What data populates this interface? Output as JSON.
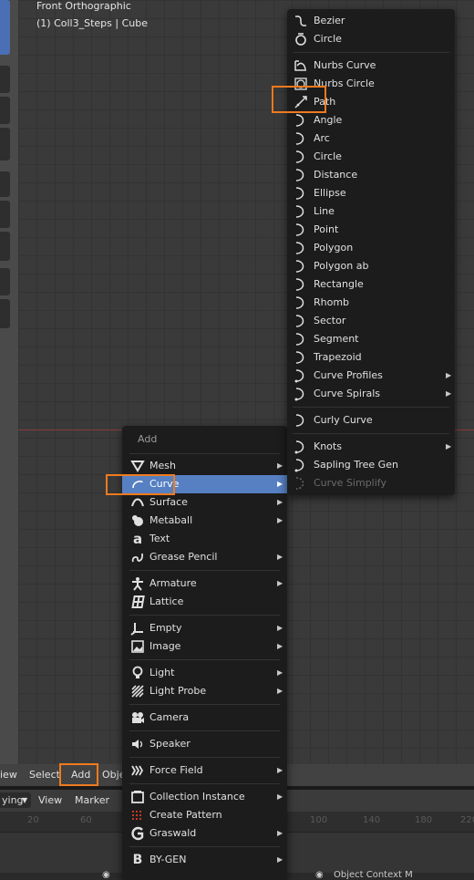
{
  "viewport": {
    "view_name": "Front Orthographic",
    "object_info": "(1) Coll3_Steps | Cube"
  },
  "header": {
    "view": "iew",
    "select": "Select",
    "add": "Add",
    "object": "Obje"
  },
  "timeline": {
    "mode": "ying",
    "view": "View",
    "marker": "Marker",
    "ticks": [
      "20",
      "60",
      "100",
      "140",
      "180",
      "220"
    ]
  },
  "statusbar": {
    "right_text": "Object Context M"
  },
  "add_menu": {
    "title": "Add",
    "items": [
      {
        "label": "Mesh",
        "icon": "mesh-icon"
      },
      {
        "label": "Curve",
        "icon": "curve-icon"
      },
      {
        "label": "Surface",
        "icon": "surface-icon"
      },
      {
        "label": "Metaball",
        "icon": "metaball-icon"
      },
      {
        "label": "Text",
        "icon": "text-icon"
      },
      {
        "label": "Grease Pencil",
        "icon": "grease-pencil-icon"
      },
      {
        "label": "Armature",
        "icon": "armature-icon"
      },
      {
        "label": "Lattice",
        "icon": "lattice-icon"
      },
      {
        "label": "Empty",
        "icon": "empty-icon"
      },
      {
        "label": "Image",
        "icon": "image-icon"
      },
      {
        "label": "Light",
        "icon": "light-icon"
      },
      {
        "label": "Light Probe",
        "icon": "light-probe-icon"
      },
      {
        "label": "Camera",
        "icon": "camera-icon"
      },
      {
        "label": "Speaker",
        "icon": "speaker-icon"
      },
      {
        "label": "Force Field",
        "icon": "force-field-icon"
      },
      {
        "label": "Collection Instance",
        "icon": "collection-icon"
      },
      {
        "label": "Create Pattern",
        "icon": "pattern-icon"
      },
      {
        "label": "Graswald",
        "icon": "graswald-icon"
      },
      {
        "label": "BY-GEN",
        "icon": "bygen-icon"
      }
    ]
  },
  "curve_menu": {
    "items": [
      {
        "label": "Bezier",
        "icon": "bezier-icon"
      },
      {
        "label": "Circle",
        "icon": "circle-icon"
      },
      {
        "label": "Nurbs Curve",
        "icon": "nurbs-curve-icon"
      },
      {
        "label": "Nurbs Circle",
        "icon": "nurbs-circle-icon"
      },
      {
        "label": "Path",
        "icon": "path-icon"
      },
      {
        "label": "Angle",
        "icon": "curve-icon"
      },
      {
        "label": "Arc",
        "icon": "curve-icon"
      },
      {
        "label": "Circle",
        "icon": "curve-icon"
      },
      {
        "label": "Distance",
        "icon": "curve-icon"
      },
      {
        "label": "Ellipse",
        "icon": "curve-icon"
      },
      {
        "label": "Line",
        "icon": "curve-icon"
      },
      {
        "label": "Point",
        "icon": "curve-icon"
      },
      {
        "label": "Polygon",
        "icon": "curve-icon"
      },
      {
        "label": "Polygon ab",
        "icon": "curve-icon"
      },
      {
        "label": "Rectangle",
        "icon": "curve-icon"
      },
      {
        "label": "Rhomb",
        "icon": "curve-icon"
      },
      {
        "label": "Sector",
        "icon": "curve-icon"
      },
      {
        "label": "Segment",
        "icon": "curve-icon"
      },
      {
        "label": "Trapezoid",
        "icon": "curve-icon"
      },
      {
        "label": "Curve Profiles",
        "icon": "curve-icon"
      },
      {
        "label": "Curve Spirals",
        "icon": "curve-icon"
      },
      {
        "label": "Curly Curve",
        "icon": "curve-icon"
      },
      {
        "label": "Knots",
        "icon": "curve-icon"
      },
      {
        "label": "Sapling Tree Gen",
        "icon": "curve-icon"
      },
      {
        "label": "Curve Simplify",
        "icon": "curve-icon"
      }
    ]
  },
  "colors": {
    "highlight": "#5680c2",
    "annotation": "#f07a1e",
    "menu_bg": "#1c1c1c"
  }
}
